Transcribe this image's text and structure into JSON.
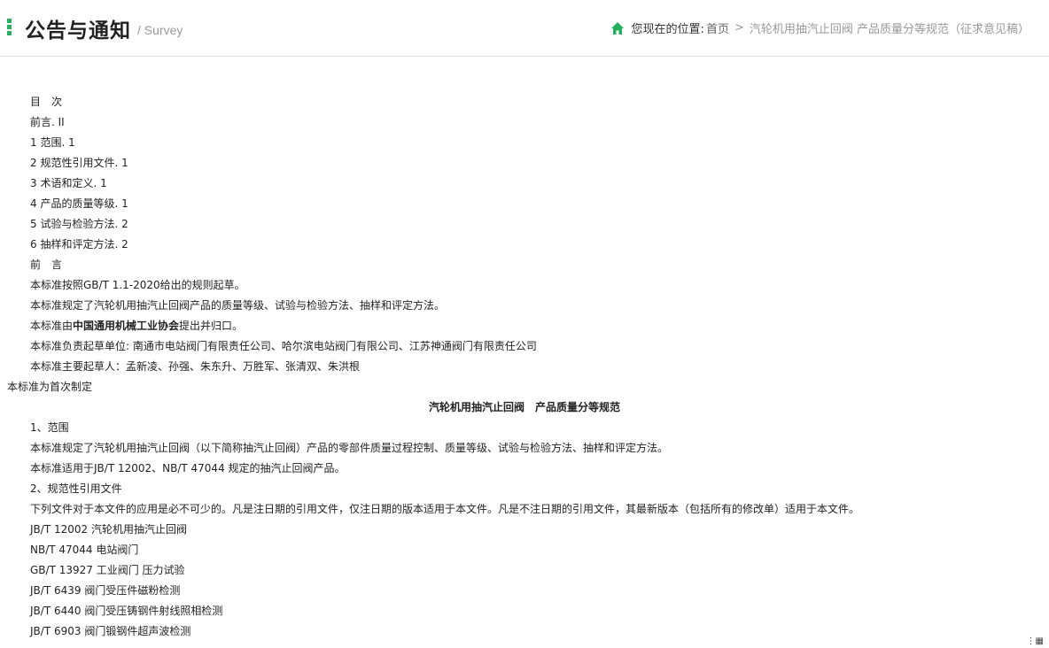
{
  "header": {
    "title": "公告与通知",
    "subtitle": "/ Survey",
    "breadcrumb": {
      "label": "您现在的位置:",
      "home": "首页",
      "separator": ">",
      "current": "汽轮机用抽汽止回阀 产品质量分等规范（征求意见稿）"
    }
  },
  "colors": {
    "accent": "#27ae60"
  },
  "document": {
    "toc_title": "目　次",
    "toc": [
      "前言. II",
      "1 范围. 1",
      "2 规范性引用文件. 1",
      "3 术语和定义. 1",
      "4 产品的质量等级. 1",
      "5 试验与检验方法. 2",
      "6 抽样和评定方法. 2"
    ],
    "foreword_title": "前　言",
    "foreword_1": "本标准按照GB/T 1.1-2020给出的规则起草。",
    "foreword_2": "本标准规定了汽轮机用抽汽止回阀产品的质量等级、试验与检验方法、抽样和评定方法。",
    "foreword_3_pre": "本标准由",
    "foreword_3_bold": "中国通用机械工业协会",
    "foreword_3_post": "提出并归口。",
    "foreword_4": "本标准负责起草单位: 南通市电站阀门有限责任公司、哈尔滨电站阀门有限公司、江苏神通阀门有限责任公司",
    "foreword_5": "本标准主要起草人：孟新凌、孙强、朱东升、万胜军、张清双、朱洪根",
    "foreword_6": "本标准为首次制定",
    "doc_title": "汽轮机用抽汽止回阀　产品质量分等规范",
    "sec1_title": "1、范围",
    "sec1_p1": "本标准规定了汽轮机用抽汽止回阀（以下简称抽汽止回阀）产品的零部件质量过程控制、质量等级、试验与检验方法、抽样和评定方法。",
    "sec1_p2": "本标准适用于JB/T 12002、NB/T 47044 规定的抽汽止回阀产品。",
    "sec2_title": "2、规范性引用文件",
    "sec2_p1": "下列文件对于本文件的应用是必不可少的。凡是注日期的引用文件，仅注日期的版本适用于本文件。凡是不注日期的引用文件，其最新版本（包括所有的修改单）适用于本文件。",
    "refs": [
      "JB/T 12002  汽轮机用抽汽止回阀",
      "NB/T 47044  电站阀门",
      "GB/T 13927  工业阀门 压力试验",
      "JB/T 6439   阀门受压件磁粉检测",
      "JB/T 6440   阀门受压铸钢件射线照相检测",
      "JB/T 6903   阀门锻钢件超声波检测"
    ]
  }
}
